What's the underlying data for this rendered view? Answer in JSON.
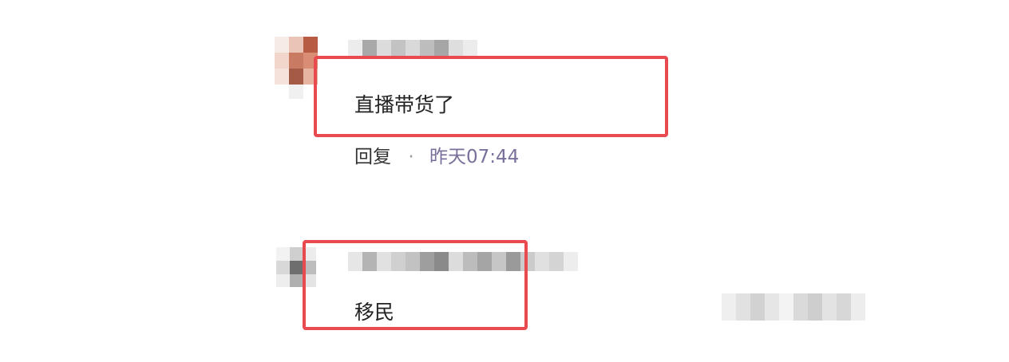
{
  "comments": [
    {
      "username": "",
      "text": "直播带货了",
      "reply_label": "回复",
      "separator": "·",
      "timestamp": "昨天07:44"
    },
    {
      "username": "",
      "text": "移民"
    }
  ],
  "colors": {
    "highlight": "#e84a4f",
    "timestamp": "#7a6f9a",
    "blur": "#c8c8c8"
  }
}
